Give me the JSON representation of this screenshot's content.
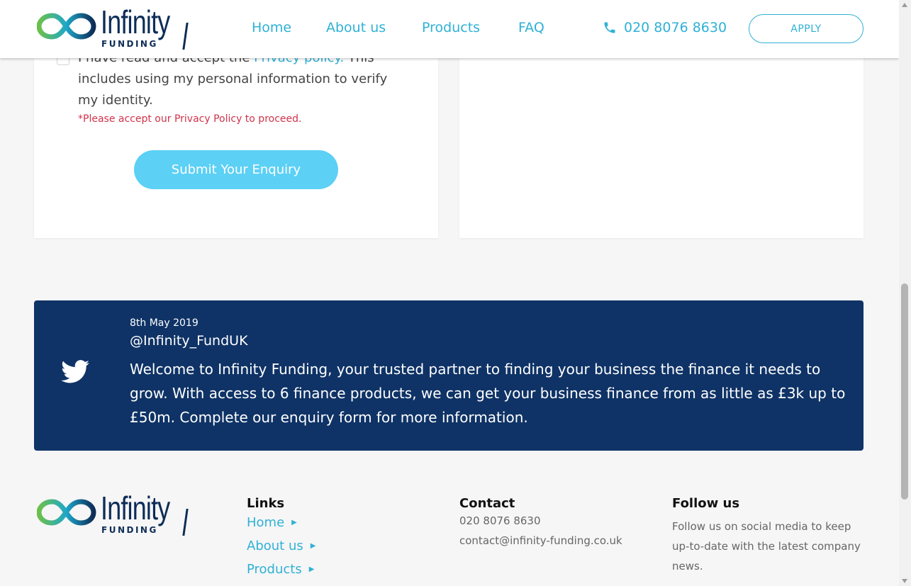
{
  "header": {
    "logo_word": "Infinity",
    "logo_sub": "FUNDING",
    "nav": [
      "Home",
      "About us",
      "Products",
      "FAQ"
    ],
    "phone": "020 8076 8630",
    "apply": "APPLY"
  },
  "form": {
    "consent_prefix": "I have read and accept the ",
    "consent_link": "Privacy policy.",
    "consent_suffix": " This includes using my personal information to verify my identity.",
    "error": "*Please accept our Privacy Policy to proceed.",
    "submit": "Submit Your Enquiry"
  },
  "tweet": {
    "date": "8th May 2019",
    "handle": "@Infinity_FundUK",
    "text": "Welcome to Infinity Funding, your trusted partner to finding your business the finance it needs to grow. With access to 6 finance products, we can get your business finance from as little as £3k up to £50m. Complete our enquiry form for more information."
  },
  "footer": {
    "logo_word": "Infinity",
    "logo_sub": "FUNDING",
    "links_heading": "Links",
    "links": [
      "Home",
      "About us",
      "Products"
    ],
    "contact_heading": "Contact",
    "contact_phone": "020 8076 8630",
    "contact_email": "contact@infinity-funding.co.uk",
    "follow_heading": "Follow us",
    "follow_text": "Follow us on social media to keep up-to-date with the latest company news."
  },
  "colors": {
    "accent": "#2fb1d6",
    "navy": "#0f3366",
    "error": "#d0334a",
    "button": "#5cd0f5"
  },
  "icons": {
    "phone": "phone-icon",
    "twitter": "twitter-icon",
    "arrow": "caret-right-icon"
  }
}
